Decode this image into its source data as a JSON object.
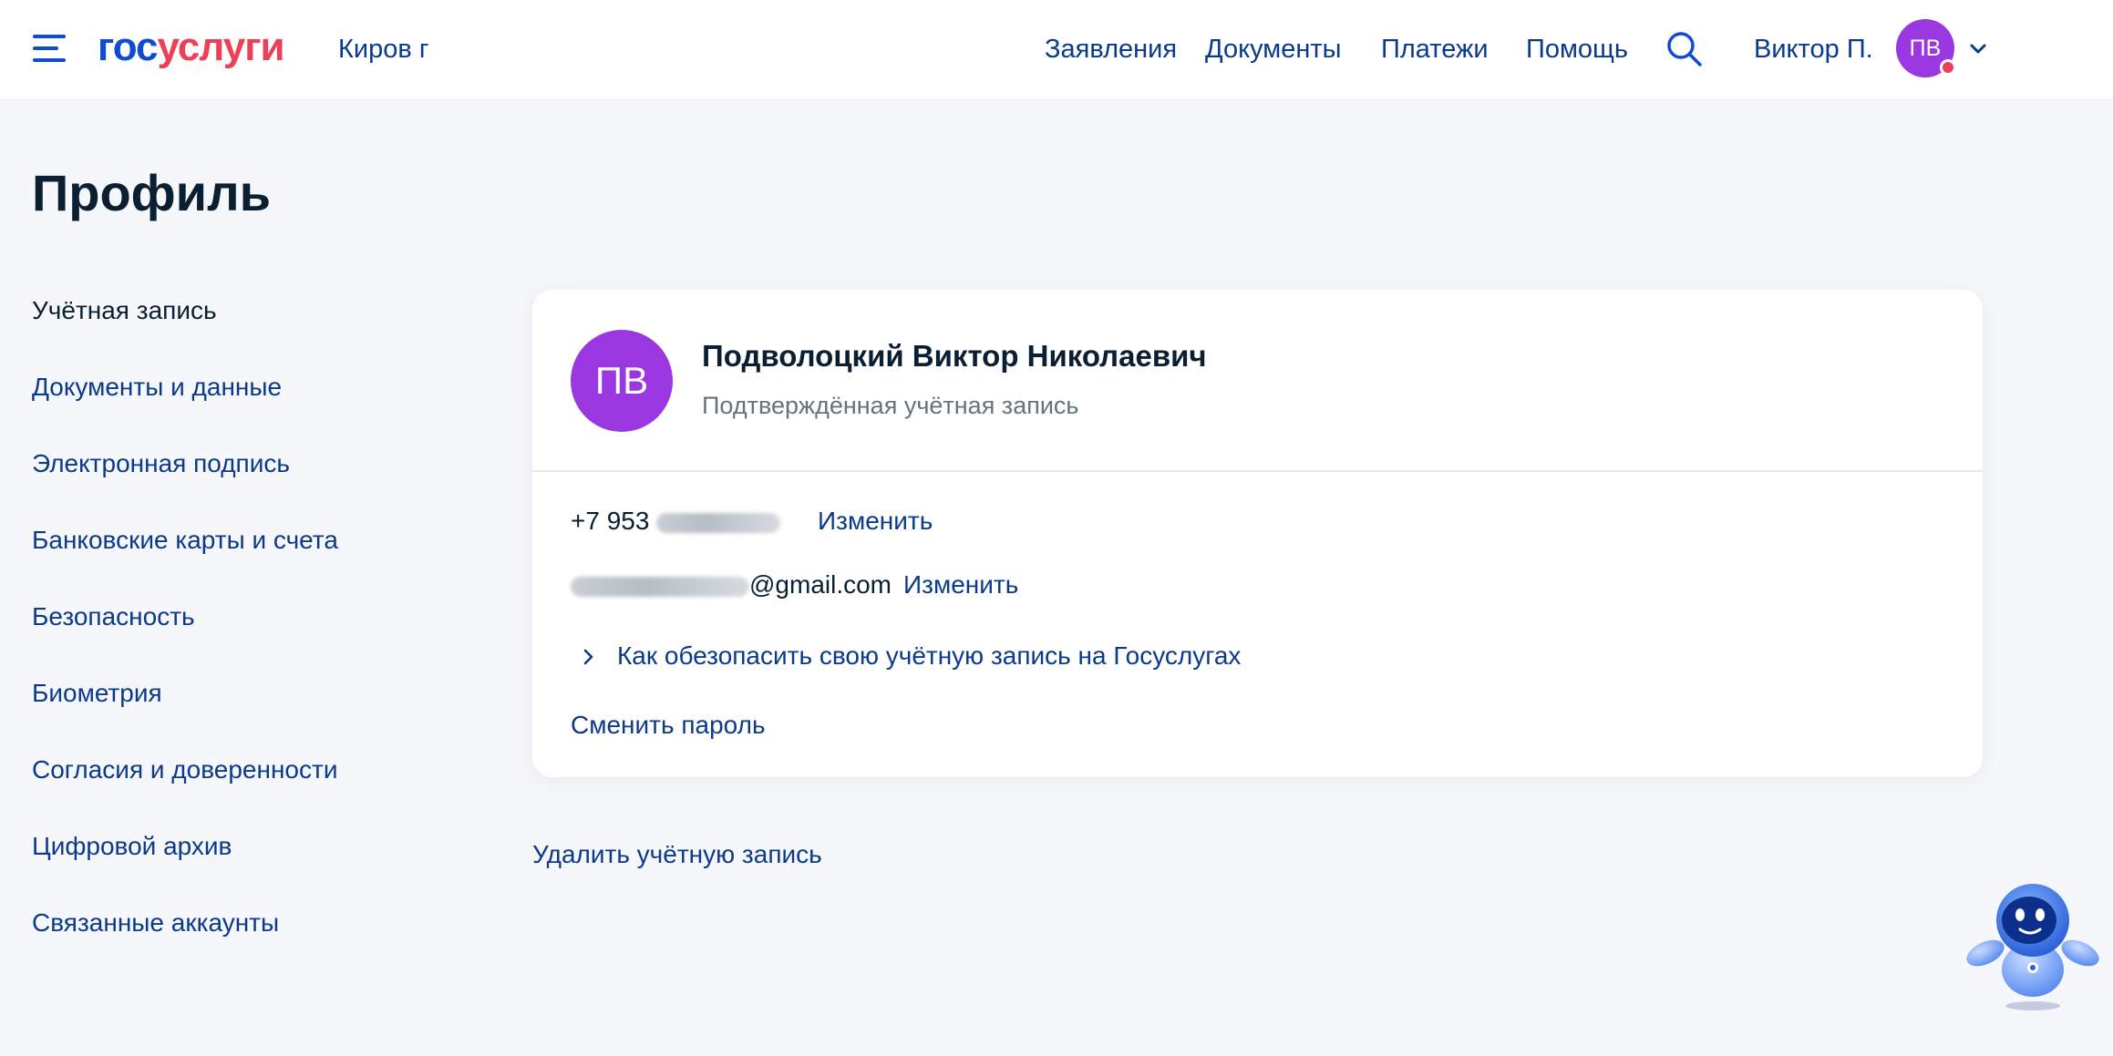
{
  "header": {
    "logo_part1": "гос",
    "logo_part2": "услуги",
    "city": "Киров г",
    "nav": [
      "Заявления",
      "Документы",
      "Платежи",
      "Помощь"
    ],
    "user_name": "Виктор П.",
    "avatar_initials": "ПВ"
  },
  "page": {
    "title": "Профиль"
  },
  "sidebar": {
    "items": [
      {
        "label": "Учётная запись",
        "active": true
      },
      {
        "label": "Документы и данные"
      },
      {
        "label": "Электронная подпись"
      },
      {
        "label": "Банковские карты и счета"
      },
      {
        "label": "Безопасность"
      },
      {
        "label": "Биометрия"
      },
      {
        "label": "Согласия и доверенности"
      },
      {
        "label": "Цифровой архив"
      },
      {
        "label": "Связанные аккаунты"
      }
    ]
  },
  "profile": {
    "initials": "ПВ",
    "full_name": "Подволоцкий Виктор Николаевич",
    "status": "Подтверждённая учётная запись",
    "phone_prefix": "+7 953",
    "email_suffix": "@gmail.com",
    "change_label": "Изменить",
    "secure_link": "Как обезопасить свою учётную запись на Госуслугах",
    "change_password": "Сменить пароль"
  },
  "delete_account": "Удалить учётную запись",
  "colors": {
    "brand_blue": "#0d4cd3",
    "brand_red": "#ee3f58",
    "link": "#0b3a8a",
    "avatar": "#9b37e0",
    "background": "#f5f7fb"
  },
  "icons": [
    "menu-icon",
    "search-icon",
    "chevron-down-icon",
    "chevron-right-icon",
    "assistant-robot-icon"
  ]
}
